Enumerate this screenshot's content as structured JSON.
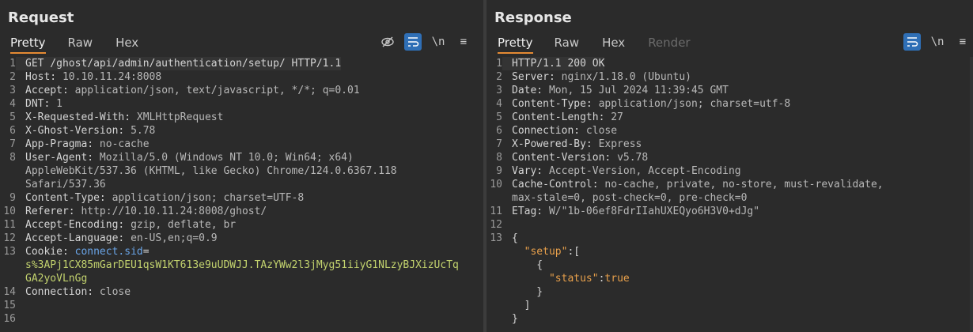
{
  "request": {
    "title": "Request",
    "tabs": [
      "Pretty",
      "Raw",
      "Hex"
    ],
    "lines": [
      {
        "n": "1",
        "parts": [
          [
            "GET /ghost/api/admin/authentication/setup/ HTTP/1.1",
            "k"
          ]
        ]
      },
      {
        "n": "2",
        "parts": [
          [
            "Host: ",
            "k"
          ],
          [
            "10.10.11.24:8008",
            "v"
          ]
        ]
      },
      {
        "n": "3",
        "parts": [
          [
            "Accept: ",
            "k"
          ],
          [
            "application/json, text/javascript, */*; q=0.01",
            "v"
          ]
        ]
      },
      {
        "n": "4",
        "parts": [
          [
            "DNT: ",
            "k"
          ],
          [
            "1",
            "v"
          ]
        ]
      },
      {
        "n": "5",
        "parts": [
          [
            "X-Requested-With: ",
            "k"
          ],
          [
            "XMLHttpRequest",
            "v"
          ]
        ]
      },
      {
        "n": "6",
        "parts": [
          [
            "X-Ghost-Version: ",
            "k"
          ],
          [
            "5.78",
            "v"
          ]
        ]
      },
      {
        "n": "7",
        "parts": [
          [
            "App-Pragma: ",
            "k"
          ],
          [
            "no-cache",
            "v"
          ]
        ]
      },
      {
        "n": "8",
        "parts": [
          [
            "User-Agent: ",
            "k"
          ],
          [
            "Mozilla/5.0 (Windows NT 10.0; Win64; x64)",
            "v"
          ]
        ]
      },
      {
        "n": "",
        "parts": [
          [
            "AppleWebKit/537.36 (KHTML, like Gecko) Chrome/124.0.6367.118",
            "v"
          ]
        ]
      },
      {
        "n": "",
        "parts": [
          [
            "Safari/537.36",
            "v"
          ]
        ]
      },
      {
        "n": "9",
        "parts": [
          [
            "Content-Type: ",
            "k"
          ],
          [
            "application/json; charset=UTF-8",
            "v"
          ]
        ]
      },
      {
        "n": "10",
        "parts": [
          [
            "Referer: ",
            "k"
          ],
          [
            "http://10.10.11.24:8008/ghost/",
            "v"
          ]
        ]
      },
      {
        "n": "11",
        "parts": [
          [
            "Accept-Encoding: ",
            "k"
          ],
          [
            "gzip, deflate, br",
            "v"
          ]
        ]
      },
      {
        "n": "12",
        "parts": [
          [
            "Accept-Language: ",
            "k"
          ],
          [
            "en-US,en;q=0.9",
            "v"
          ]
        ]
      },
      {
        "n": "13",
        "parts": [
          [
            "Cookie: ",
            "k"
          ],
          [
            "connect.sid",
            "blue"
          ],
          [
            "=",
            "k"
          ]
        ]
      },
      {
        "n": "",
        "parts": [
          [
            "s%3APj1CX85mGarDEU1qsW1KT613e9uUDWJJ.TAzYWw2l3jMyg51iiyG1NLzyBJXizUcTq",
            "green"
          ]
        ]
      },
      {
        "n": "",
        "parts": [
          [
            "GA2yoVLnGg",
            "green"
          ]
        ]
      },
      {
        "n": "14",
        "parts": [
          [
            "Connection: ",
            "k"
          ],
          [
            "close",
            "v"
          ]
        ]
      },
      {
        "n": "15",
        "parts": []
      },
      {
        "n": "16",
        "parts": []
      }
    ]
  },
  "response": {
    "title": "Response",
    "tabs": [
      "Pretty",
      "Raw",
      "Hex",
      "Render"
    ],
    "lines": [
      {
        "n": "1",
        "parts": [
          [
            "HTTP/1.1 200 OK",
            "k"
          ]
        ]
      },
      {
        "n": "2",
        "parts": [
          [
            "Server: ",
            "k"
          ],
          [
            "nginx/1.18.0 (Ubuntu)",
            "v"
          ]
        ]
      },
      {
        "n": "3",
        "parts": [
          [
            "Date: ",
            "k"
          ],
          [
            "Mon, 15 Jul 2024 11:39:45 GMT",
            "v"
          ]
        ]
      },
      {
        "n": "4",
        "parts": [
          [
            "Content-Type: ",
            "k"
          ],
          [
            "application/json; charset=utf-8",
            "v"
          ]
        ]
      },
      {
        "n": "5",
        "parts": [
          [
            "Content-Length: ",
            "k"
          ],
          [
            "27",
            "v"
          ]
        ]
      },
      {
        "n": "6",
        "parts": [
          [
            "Connection: ",
            "k"
          ],
          [
            "close",
            "v"
          ]
        ]
      },
      {
        "n": "7",
        "parts": [
          [
            "X-Powered-By: ",
            "k"
          ],
          [
            "Express",
            "v"
          ]
        ]
      },
      {
        "n": "8",
        "parts": [
          [
            "Content-Version: ",
            "k"
          ],
          [
            "v5.78",
            "v"
          ]
        ]
      },
      {
        "n": "9",
        "parts": [
          [
            "Vary: ",
            "k"
          ],
          [
            "Accept-Version, Accept-Encoding",
            "v"
          ]
        ]
      },
      {
        "n": "10",
        "parts": [
          [
            "Cache-Control: ",
            "k"
          ],
          [
            "no-cache, private, no-store, must-revalidate,",
            "v"
          ]
        ]
      },
      {
        "n": "",
        "parts": [
          [
            "max-stale=0, post-check=0, pre-check=0",
            "v"
          ]
        ]
      },
      {
        "n": "11",
        "parts": [
          [
            "ETag: ",
            "k"
          ],
          [
            "W/\"1b-06ef8FdrIIahUXEQyo6H3V0+dJg\"",
            "v"
          ]
        ]
      },
      {
        "n": "12",
        "parts": []
      },
      {
        "n": "13",
        "parts": [
          [
            "{",
            "k"
          ]
        ]
      },
      {
        "n": "",
        "parts": [
          [
            "  ",
            "k"
          ],
          [
            "\"setup\"",
            "jsonk"
          ],
          [
            ":[",
            "k"
          ]
        ]
      },
      {
        "n": "",
        "parts": [
          [
            "    {",
            "k"
          ]
        ]
      },
      {
        "n": "",
        "parts": [
          [
            "      ",
            "k"
          ],
          [
            "\"status\"",
            "jsonk"
          ],
          [
            ":",
            "k"
          ],
          [
            "true",
            "jsonv"
          ]
        ]
      },
      {
        "n": "",
        "parts": [
          [
            "    }",
            "k"
          ]
        ]
      },
      {
        "n": "",
        "parts": [
          [
            "  ]",
            "k"
          ]
        ]
      },
      {
        "n": "",
        "parts": [
          [
            "}",
            "k"
          ]
        ]
      }
    ]
  },
  "toolbar": {
    "newline_label": "\\n",
    "menu_label": "≡"
  }
}
